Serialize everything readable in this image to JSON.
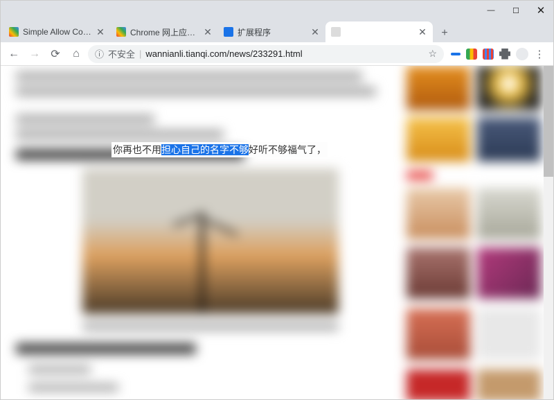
{
  "window": {
    "minimize": "—",
    "maximize": "☐",
    "close": "✕"
  },
  "tabs": [
    {
      "title": "Simple Allow Copy - Chrome",
      "close": "✕"
    },
    {
      "title": "Chrome 网上应用店 - 扩展程序",
      "close": "✕"
    },
    {
      "title": "扩展程序",
      "close": "✕"
    },
    {
      "title": "",
      "close": "✕"
    }
  ],
  "new_tab": "+",
  "nav": {
    "back": "←",
    "forward": "→",
    "reload": "⟳",
    "home": "⌂"
  },
  "omnibox": {
    "info_icon": "ⓘ",
    "security_label": "不安全",
    "divider": "|",
    "url": "wannianli.tianqi.com/news/233291.html",
    "star": "☆"
  },
  "ext_menu": "⋮",
  "article": {
    "text_before": "你再也不用",
    "text_selected": "担心自己的名字不够",
    "text_after": "好听不够福气了，"
  }
}
